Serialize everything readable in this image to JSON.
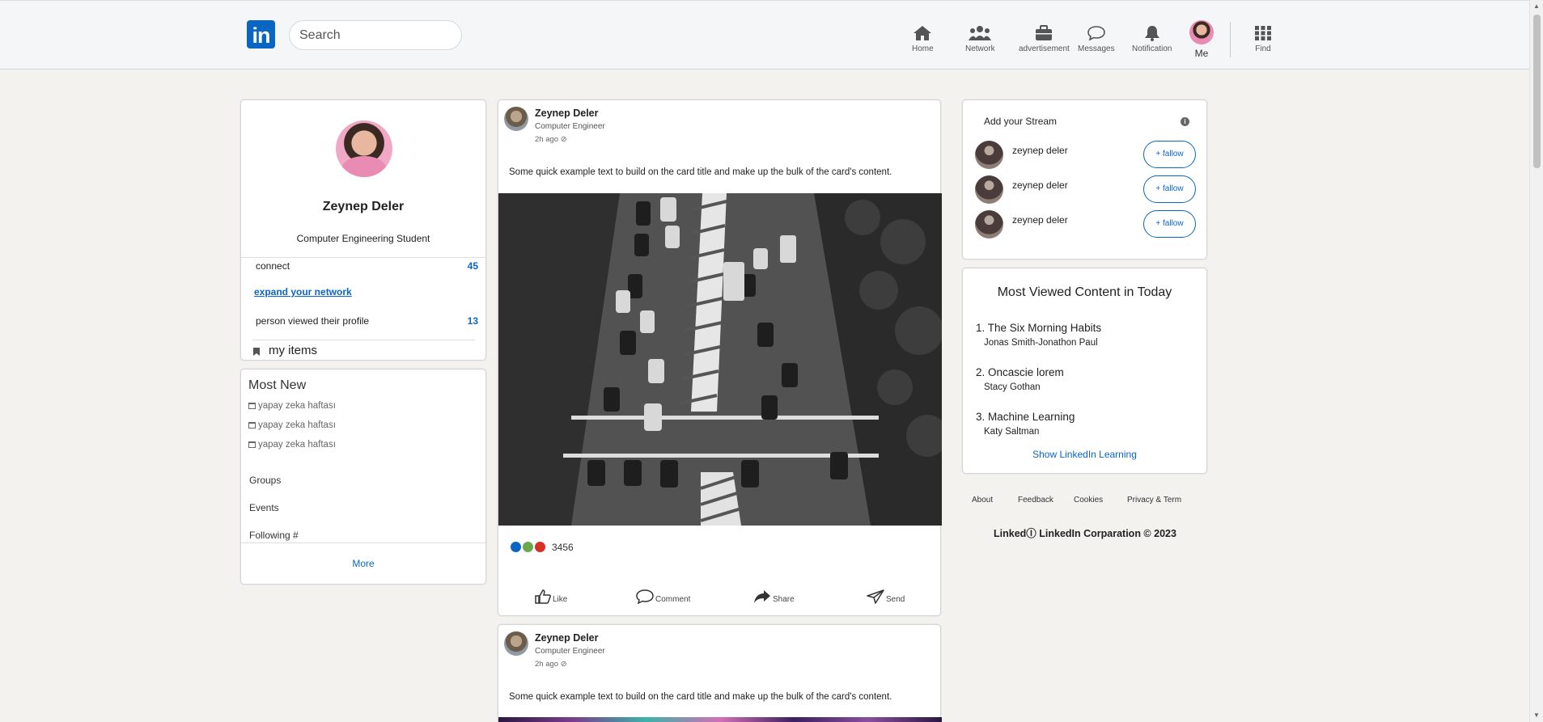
{
  "header": {
    "logo_text": "in",
    "search_placeholder": "Search",
    "nav": [
      {
        "label": "Home",
        "icon": "home-icon"
      },
      {
        "label": "Network",
        "icon": "network-icon"
      },
      {
        "label": "advertisement",
        "icon": "briefcase-icon"
      },
      {
        "label": "Messages",
        "icon": "message-icon"
      },
      {
        "label": "Notification",
        "icon": "bell-icon"
      },
      {
        "label": "Me",
        "icon": "avatar"
      },
      {
        "label": "Find",
        "icon": "grid-icon"
      }
    ]
  },
  "profile": {
    "name": "Zeynep Deler",
    "title": "Computer Engineering Student",
    "connect_label": "connect",
    "connect_count": "45",
    "expand_label": "expand your network",
    "viewed_label": "person viewed their profile",
    "viewed_count": "13",
    "my_items_label": "my items"
  },
  "most_new": {
    "title": "Most New",
    "items": [
      "yapay zeka haftası",
      "yapay zeka haftası",
      "yapay zeka haftası"
    ],
    "links": [
      "Groups",
      "Events",
      "Following #"
    ],
    "more_label": "More"
  },
  "posts": [
    {
      "author": "Zeynep Deler",
      "role": "Computer Engineer",
      "time": "2h ago ⊘",
      "text": "Some quick example text to build on the card title and make up the bulk of the card's content.",
      "reaction_count": "3456",
      "actions": [
        "Like",
        "Comment",
        "Share",
        "Send"
      ]
    },
    {
      "author": "Zeynep Deler",
      "role": "Computer Engineer",
      "time": "2h ago ⊘",
      "text": "Some quick example text to build on the card title and make up the bulk of the card's content."
    }
  ],
  "stream": {
    "title": "Add your Stream",
    "people": [
      {
        "name": "zeynep deler",
        "button": "+ fallow"
      },
      {
        "name": "zeynep deler",
        "button": "+ fallow"
      },
      {
        "name": "zeynep deler",
        "button": "+ fallow"
      }
    ]
  },
  "most_viewed": {
    "title": "Most Viewed Content in Today",
    "items": [
      {
        "title": "1. The Six Morning Habits",
        "author": "Jonas Smith-Jonathon Paul"
      },
      {
        "title": "2. Oncascie lorem",
        "author": "Stacy Gothan"
      },
      {
        "title": "3. Machine Learning",
        "author": "Katy Saltman"
      }
    ],
    "show_label": "Show LinkedIn Learning"
  },
  "footer": {
    "links": [
      "About",
      "Feedback",
      "Cookies",
      "Privacy & Term"
    ],
    "copyright": "LinkedⒾ LinkedIn Corparation © 2023"
  },
  "colors": {
    "brand": "#0a66c2",
    "background": "#f3f2ef"
  }
}
